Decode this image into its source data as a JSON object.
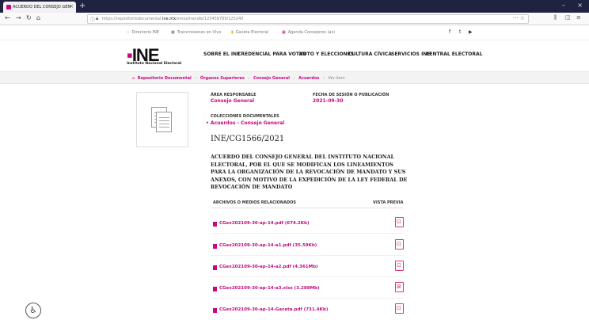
{
  "browser": {
    "tab_title": "ACUERDO DEL CONSEJO GEN",
    "tab_close": "×",
    "new_tab": "+",
    "back": "←",
    "forward": "→",
    "reload": "↻",
    "home": "⌂",
    "url_prefix": "https://repositoriodocumental.",
    "url_domain": "ine.mx",
    "url_path": "/xmlui/handle/123456789/125240",
    "url_actions": "··· ☆",
    "library": "⫼",
    "sidebar_toggle": "◫",
    "menu": "≡",
    "minimize": "–",
    "close": "×"
  },
  "utility": {
    "directorio": "Directorio INE",
    "transmisiones": "Transmisiones en Vivo",
    "gaceta": "Gaceta Electoral",
    "agenda": "Agenda Consejeros (as)",
    "social": [
      "f",
      "t",
      "▶"
    ]
  },
  "header": {
    "logo_text": "INE",
    "logo_subtitle": "Instituto Nacional Electoral",
    "menu": [
      "SOBRE EL INE",
      "CREDENCIAL PARA VOTAR",
      "VOTO Y ELECCIONES",
      "CULTURA CÍVICA",
      "SERVICIOS INE",
      "CENTRAL ELECTORAL"
    ]
  },
  "breadcrumb": {
    "items": [
      "Repositorio Documental",
      "Órganos Superiores",
      "Consejo General",
      "Acuerdos"
    ],
    "separator": "›",
    "current": "Ver ítem"
  },
  "doc": {
    "area_label": "ÁREA RESPONSABLE",
    "area_value": "Consejo General",
    "date_label": "FECHA DE SESIÓN O PUBLICACIÓN",
    "date_value": "2021-09-30",
    "collections_label": "COLECCIONES DOCUMENTALES",
    "collection_item": "• Acuerdos - Consejo General",
    "code": "INE/CG1566/2021",
    "title": "ACUERDO DEL CONSEJO GENERAL DEL INSTITUTO NACIONAL ELECTORAL, POR EL QUE SE MODIFICAN LOS LINEAMIENTOS PARA LA ORGANIZACIÓN DE LA REVOCACIÓN DE MANDATO Y SUS ANEXOS, CON MOTIVO DE LA EXPEDICIÓN DE LA LEY FEDERAL DE REVOCACIÓN DE MANDATO"
  },
  "files": {
    "header_left": "ARCHIVOS O MEDIOS RELACIONADOS",
    "header_right": "VISTA PREVIA",
    "items": [
      {
        "name": "CGex202109-30-ap-14.pdf (674.2Kb)",
        "kind": "pdf"
      },
      {
        "name": "CGex202109-30-ap-14-a1.pdf (35.59Kb)",
        "kind": "pdf"
      },
      {
        "name": "CGex202109-30-ap-14-a2.pdf (4.361Mb)",
        "kind": "pdf"
      },
      {
        "name": "CGex202109-30-ap-14-a3.xlsx (3.288Mb)",
        "kind": "xlsx"
      },
      {
        "name": "CGex202109-30-ap-14-Gaceta.pdf (731.4Kb)",
        "kind": "pdf"
      }
    ]
  },
  "icons": {
    "pdf": "⊡",
    "xlsx": "⊠",
    "accessibility": "♿"
  },
  "colors": {
    "brand": "#c5087d",
    "titlebar": "#202340"
  }
}
